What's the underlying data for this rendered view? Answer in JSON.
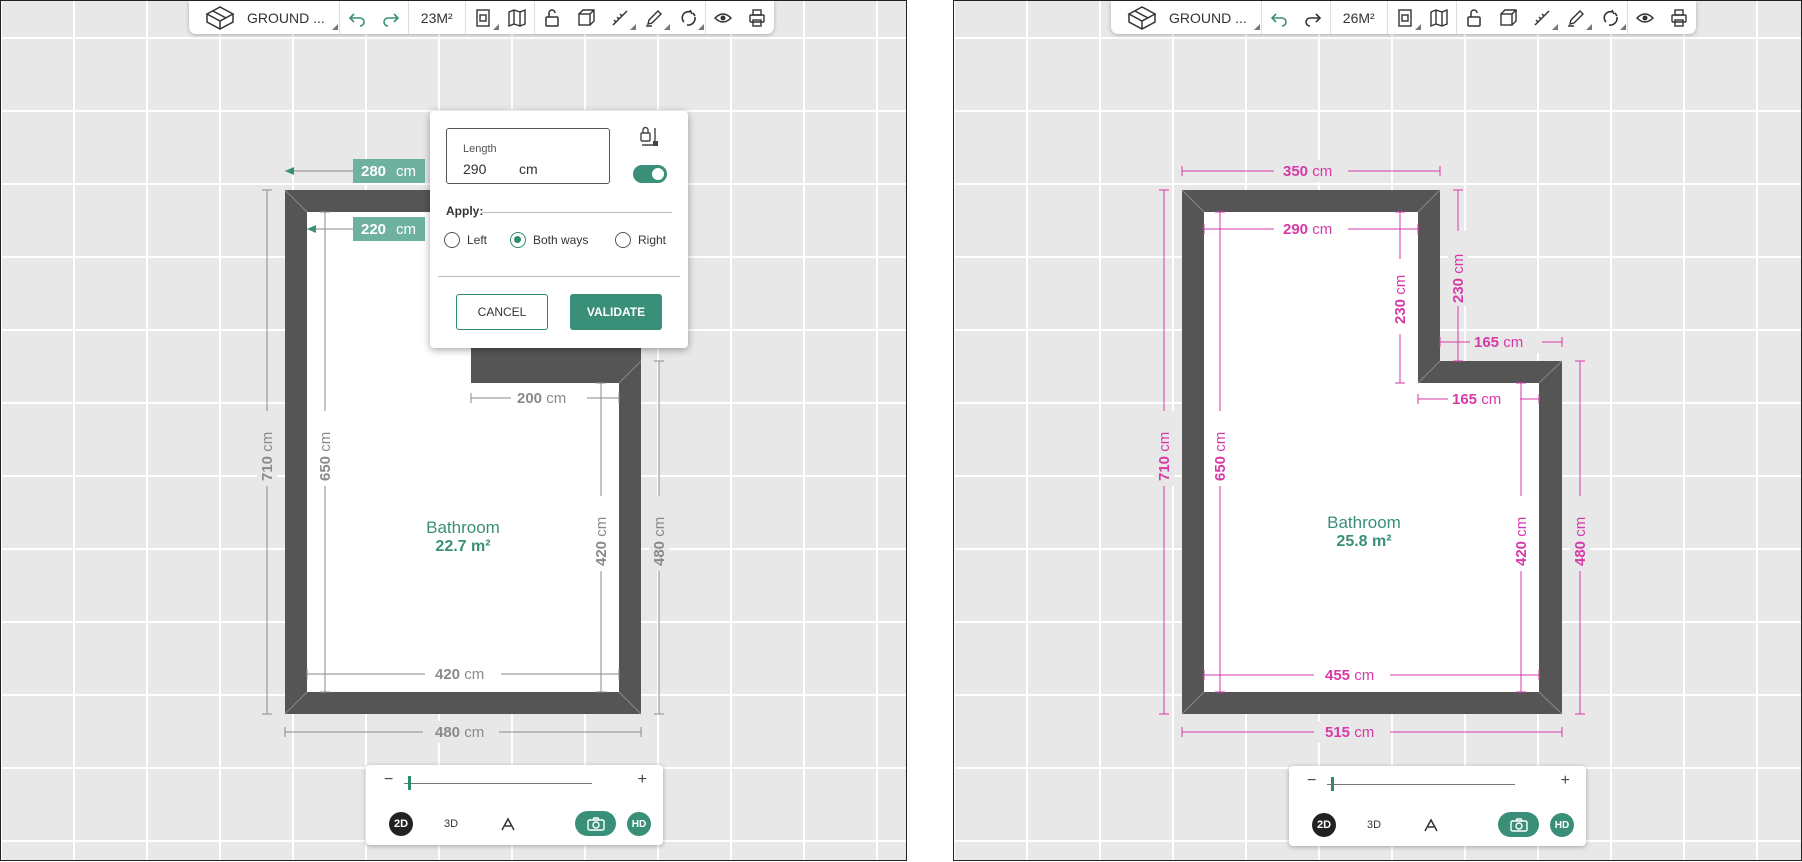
{
  "colors": {
    "accent": "#3a8f78",
    "wall": "#555555",
    "left_dim": "#8a8a8a",
    "right_dim": "#d63aa8"
  },
  "icons": [
    "floor-plan-icon",
    "undo-icon",
    "redo-icon",
    "room-icon",
    "map-icon",
    "unlock-icon",
    "cube-icon",
    "ruler-icon",
    "pencil-icon",
    "magnet-icon",
    "eye-icon",
    "print-icon",
    "lock-dimension-icon",
    "camera-icon",
    "perspective-icon"
  ],
  "left": {
    "toolbar": {
      "level": "GROUND ...",
      "area": "23M²"
    },
    "room": {
      "name": "Bathroom",
      "area": "22.7 m²"
    },
    "dims": {
      "top_outer": "280",
      "top_inner": "220",
      "step": "200",
      "left_outer": "710",
      "left_inner": "650",
      "right_inner": "420",
      "right_outer": "480",
      "bottom_inner": "420",
      "bottom_outer": "480",
      "unit": "cm"
    },
    "dialog": {
      "length_label": "Length",
      "length_value": "290",
      "length_unit": "cm",
      "apply_label": "Apply:",
      "options": [
        "Left",
        "Both ways",
        "Right"
      ],
      "selected": "Both ways",
      "toggle_on": true,
      "cancel": "CANCEL",
      "validate": "VALIDATE"
    },
    "zoom": {
      "minus": "−",
      "plus": "+",
      "btn_2d": "2D",
      "btn_3d": "3D",
      "btn_hd": "HD"
    }
  },
  "right": {
    "toolbar": {
      "level": "GROUND ...",
      "area": "26M²"
    },
    "room": {
      "name": "Bathroom",
      "area": "25.8 m²"
    },
    "dims": {
      "top_outer": "350",
      "top_inner": "290",
      "notch_inner": "230",
      "notch_outer": "230",
      "step_outer": "165",
      "step_inner": "165",
      "left_outer": "710",
      "left_inner": "650",
      "right_inner": "420",
      "right_outer": "480",
      "bottom_inner": "455",
      "bottom_outer": "515",
      "unit": "cm"
    },
    "zoom": {
      "minus": "−",
      "plus": "+",
      "btn_2d": "2D",
      "btn_3d": "3D",
      "btn_hd": "HD"
    }
  }
}
